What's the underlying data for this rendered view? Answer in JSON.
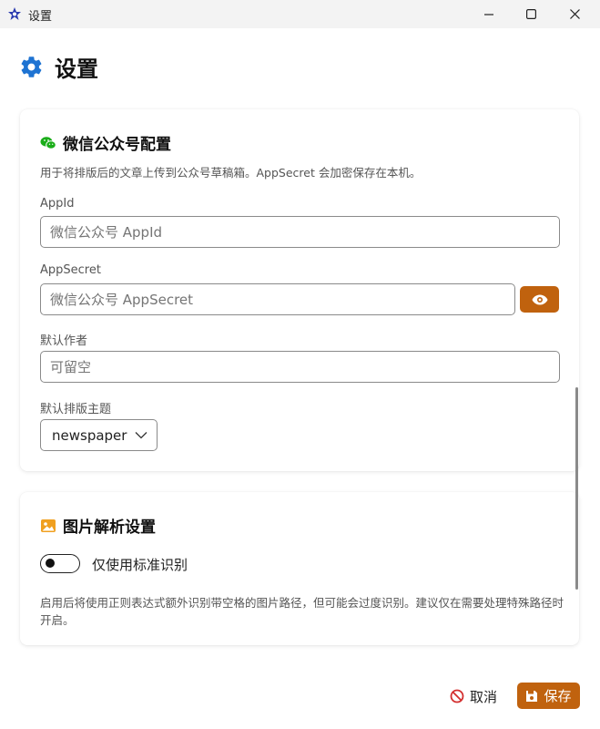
{
  "window": {
    "title": "设置",
    "icons": [
      "app-star-icon",
      "minimize-icon",
      "maximize-icon",
      "close-icon"
    ]
  },
  "page": {
    "title": "设置",
    "icon": "gear-icon"
  },
  "wechat_card": {
    "title": "微信公众号配置",
    "icon": "wechat-icon",
    "description": "用于将排版后的文章上传到公众号草稿箱。AppSecret 会加密保存在本机。",
    "appid_label": "AppId",
    "appid_value": "",
    "appid_placeholder": "微信公众号 AppId",
    "appsecret_label": "AppSecret",
    "appsecret_value": "",
    "appsecret_placeholder": "微信公众号 AppSecret",
    "author_label": "默认作者",
    "author_value": "",
    "author_placeholder": "可留空",
    "theme_label": "默认排版主题",
    "theme_selected": "newspaper"
  },
  "image_card": {
    "title": "图片解析设置",
    "icon": "image-icon",
    "toggle_label": "仅使用标准识别",
    "toggle_on": false,
    "description": "启用后将使用正则表达式额外识别带空格的图片路径，但可能会过度识别。建议仅在需要处理特殊路径时开启。"
  },
  "footer": {
    "cancel_label": "取消",
    "save_label": "保存"
  },
  "colors": {
    "accent": "#c0620e",
    "gear": "#1e73d2",
    "wechat": "#1aad19",
    "image_icon": "#f0a020",
    "cancel_icon": "#d32f2f"
  }
}
